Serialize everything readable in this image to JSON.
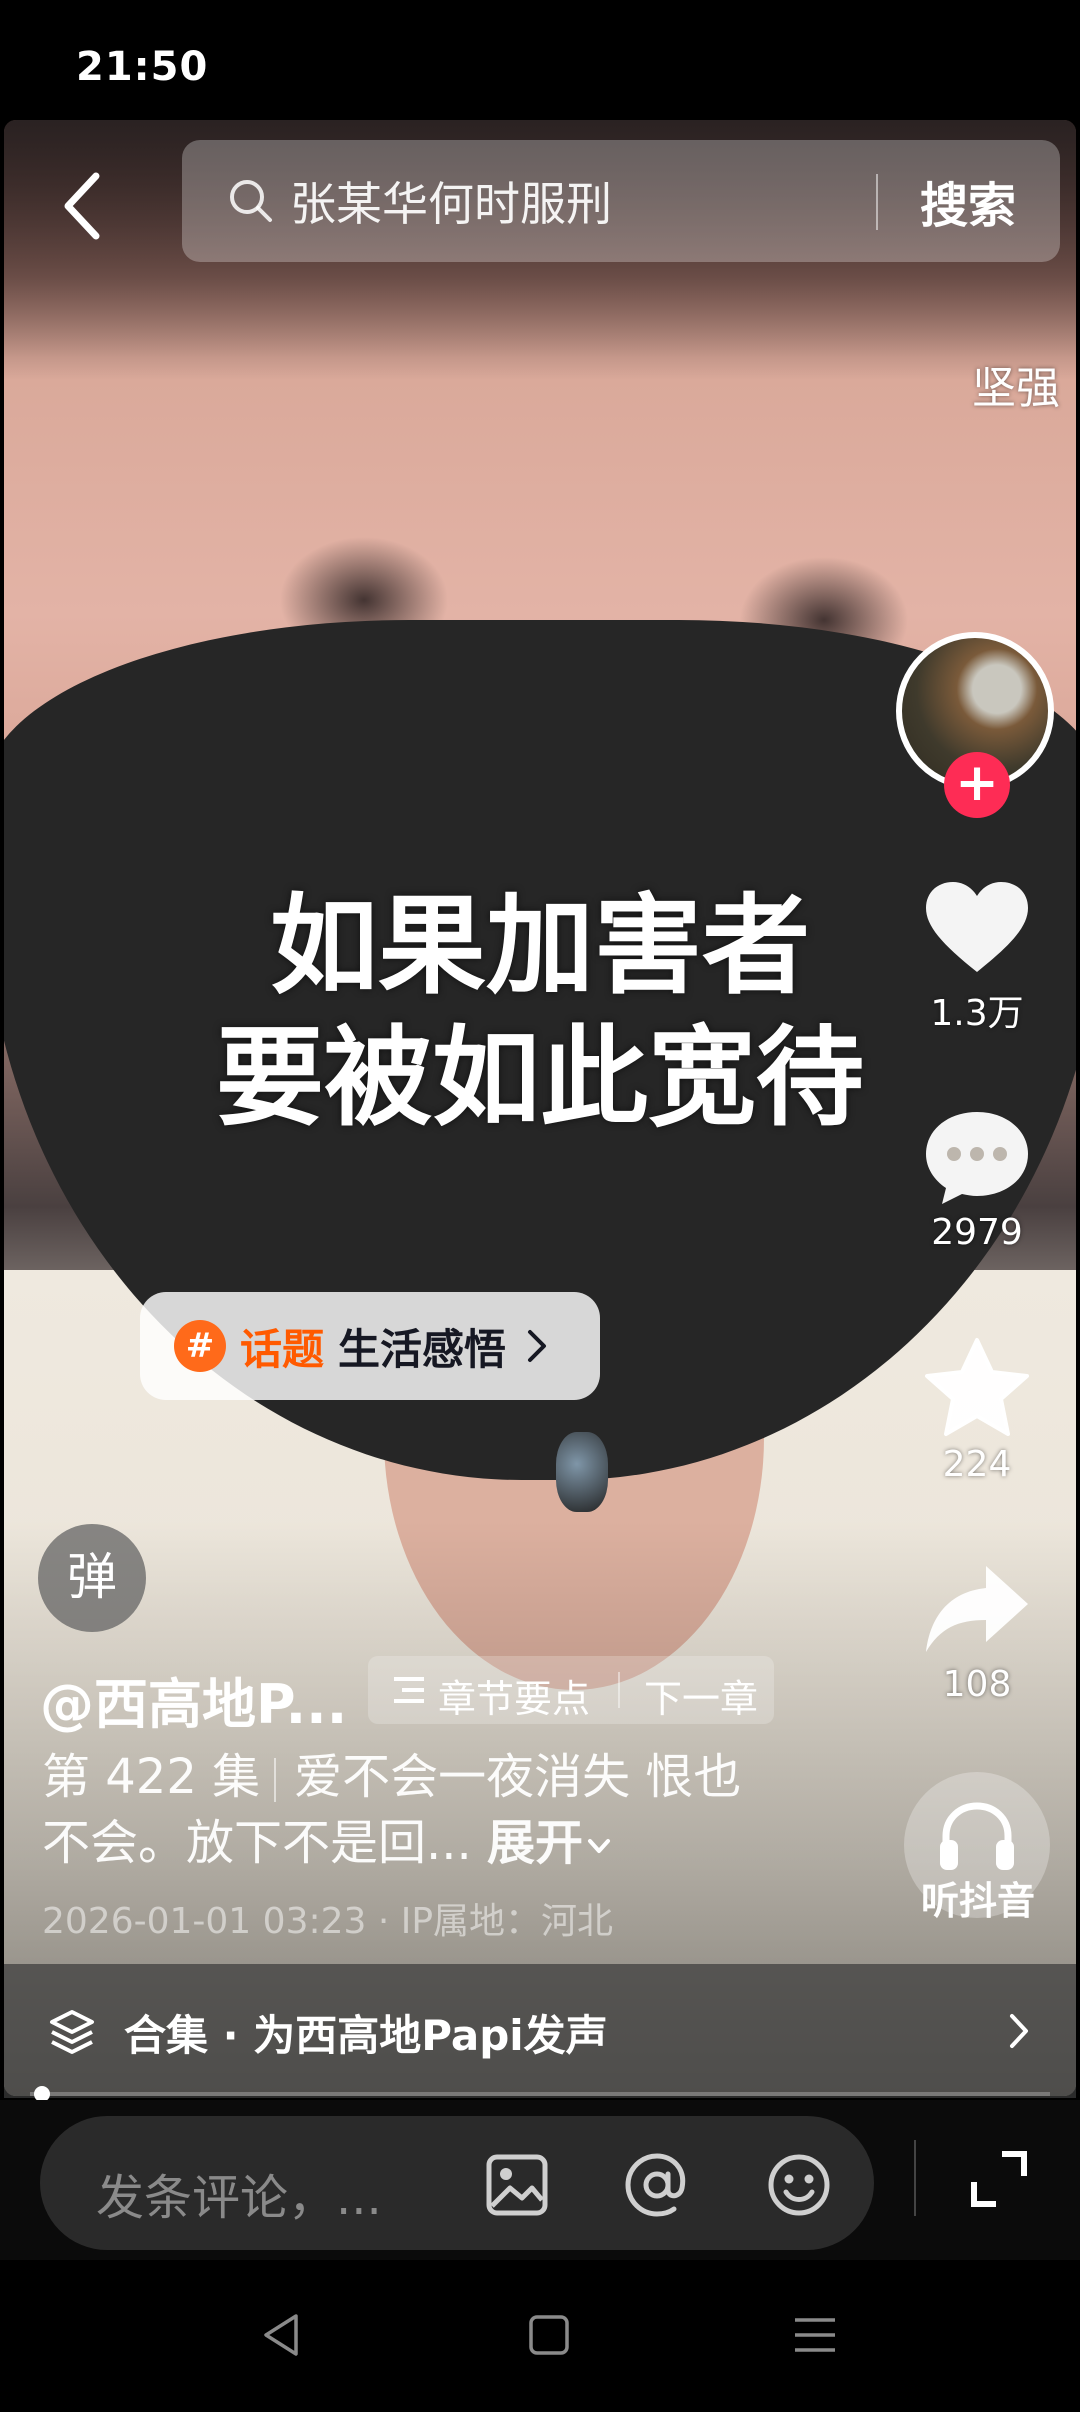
{
  "status_bar": {
    "time": "21:50"
  },
  "search": {
    "query": "张某华何时服刑",
    "button_label": "搜索"
  },
  "video": {
    "overlay_title_lines": [
      "如果加害者",
      "要被如此宽待"
    ],
    "side_tag": "坚强"
  },
  "actions": {
    "likes": "1.3万",
    "comments": "2979",
    "favorites": "224",
    "shares": "108",
    "listen_label": "听抖音"
  },
  "topic": {
    "keyword": "话题",
    "name": "生活感悟"
  },
  "danmaku_label": "弹",
  "author": "@西高地P...",
  "chapter": {
    "points_label": "章节要点",
    "next_label": "下一章"
  },
  "description": {
    "episode": "第 422 集",
    "text": "爱不会一夜消失 恨也不会。放下不是回...",
    "expand_label": "展开"
  },
  "meta": "2026-01-01 03:23 · IP属地：河北",
  "collection": {
    "label": "合集 · 为西高地Papi发声"
  },
  "comment": {
    "placeholder": "发条评论，..."
  },
  "colors": {
    "accent": "#fe2c55",
    "topic_orange": "#ff5a00"
  },
  "icons": [
    "back-icon",
    "search-icon",
    "heart-icon",
    "comment-icon",
    "star-icon",
    "share-icon",
    "headphones-icon",
    "layers-icon",
    "image-icon",
    "at-icon",
    "emoji-icon",
    "fullscreen-icon"
  ]
}
